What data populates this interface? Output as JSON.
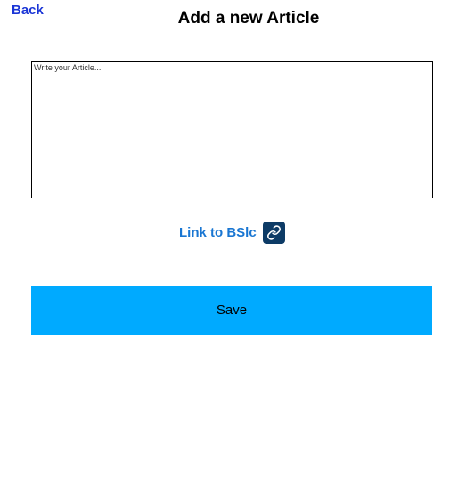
{
  "header": {
    "back_label": "Back",
    "title": "Add a new Article"
  },
  "article": {
    "placeholder": "Write your Article...",
    "value": ""
  },
  "link": {
    "label": "Link to BSlc",
    "icon": "link-icon"
  },
  "actions": {
    "save_label": "Save"
  },
  "colors": {
    "back_link": "#1a35d6",
    "link_label": "#1976d2",
    "link_icon_bg": "#0d3b66",
    "save_button_bg": "#00aaff"
  }
}
